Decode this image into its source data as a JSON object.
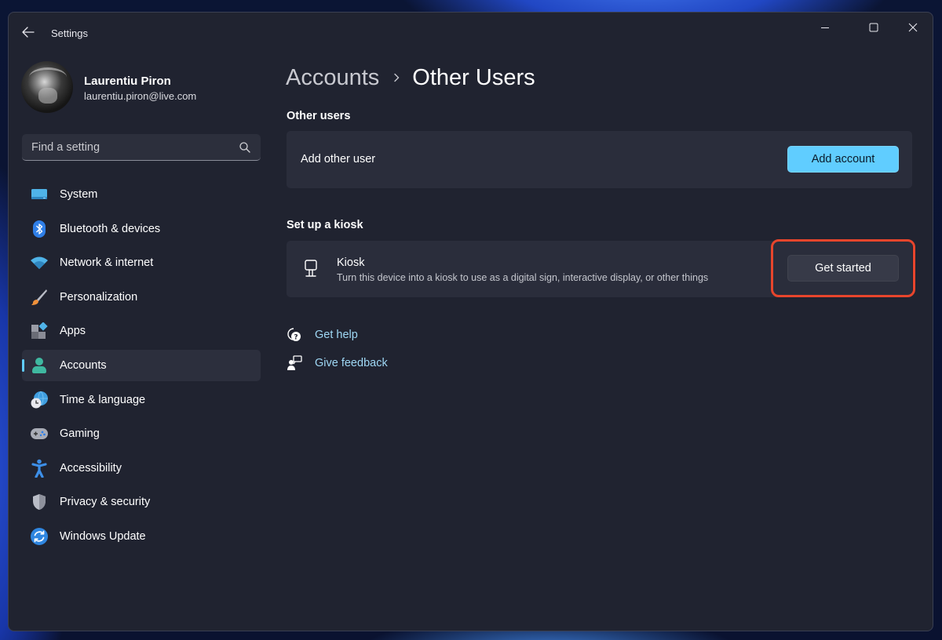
{
  "window": {
    "title": "Settings",
    "controls": {
      "minimize": "minimize",
      "maximize": "maximize",
      "close": "close"
    }
  },
  "profile": {
    "name": "Laurentiu Piron",
    "email": "laurentiu.piron@live.com"
  },
  "search": {
    "placeholder": "Find a setting",
    "value": ""
  },
  "sidebar": {
    "items": [
      {
        "label": "System",
        "icon": "system-icon",
        "active": false
      },
      {
        "label": "Bluetooth & devices",
        "icon": "bluetooth-icon",
        "active": false
      },
      {
        "label": "Network & internet",
        "icon": "wifi-icon",
        "active": false
      },
      {
        "label": "Personalization",
        "icon": "paintbrush-icon",
        "active": false
      },
      {
        "label": "Apps",
        "icon": "apps-icon",
        "active": false
      },
      {
        "label": "Accounts",
        "icon": "accounts-icon",
        "active": true
      },
      {
        "label": "Time & language",
        "icon": "time-language-icon",
        "active": false
      },
      {
        "label": "Gaming",
        "icon": "gamepad-icon",
        "active": false
      },
      {
        "label": "Accessibility",
        "icon": "accessibility-icon",
        "active": false
      },
      {
        "label": "Privacy & security",
        "icon": "shield-icon",
        "active": false
      },
      {
        "label": "Windows Update",
        "icon": "update-icon",
        "active": false
      }
    ]
  },
  "breadcrumb": {
    "parent": "Accounts",
    "separator_icon": "chevron-right-icon",
    "current": "Other Users"
  },
  "sections": {
    "other_users": {
      "title": "Other users",
      "row_label": "Add other user",
      "button": "Add account"
    },
    "kiosk": {
      "title": "Set up a kiosk",
      "row_title": "Kiosk",
      "row_description": "Turn this device into a kiosk to use as a digital sign, interactive display, or other things",
      "button": "Get started",
      "icon": "kiosk-icon"
    }
  },
  "links": [
    {
      "label": "Get help",
      "icon": "help-icon"
    },
    {
      "label": "Give feedback",
      "icon": "feedback-icon"
    }
  ],
  "colors": {
    "accent": "#60cdff",
    "highlight": "#e8452c",
    "window_bg": "#202330",
    "card_bg": "#2a2d3b"
  }
}
